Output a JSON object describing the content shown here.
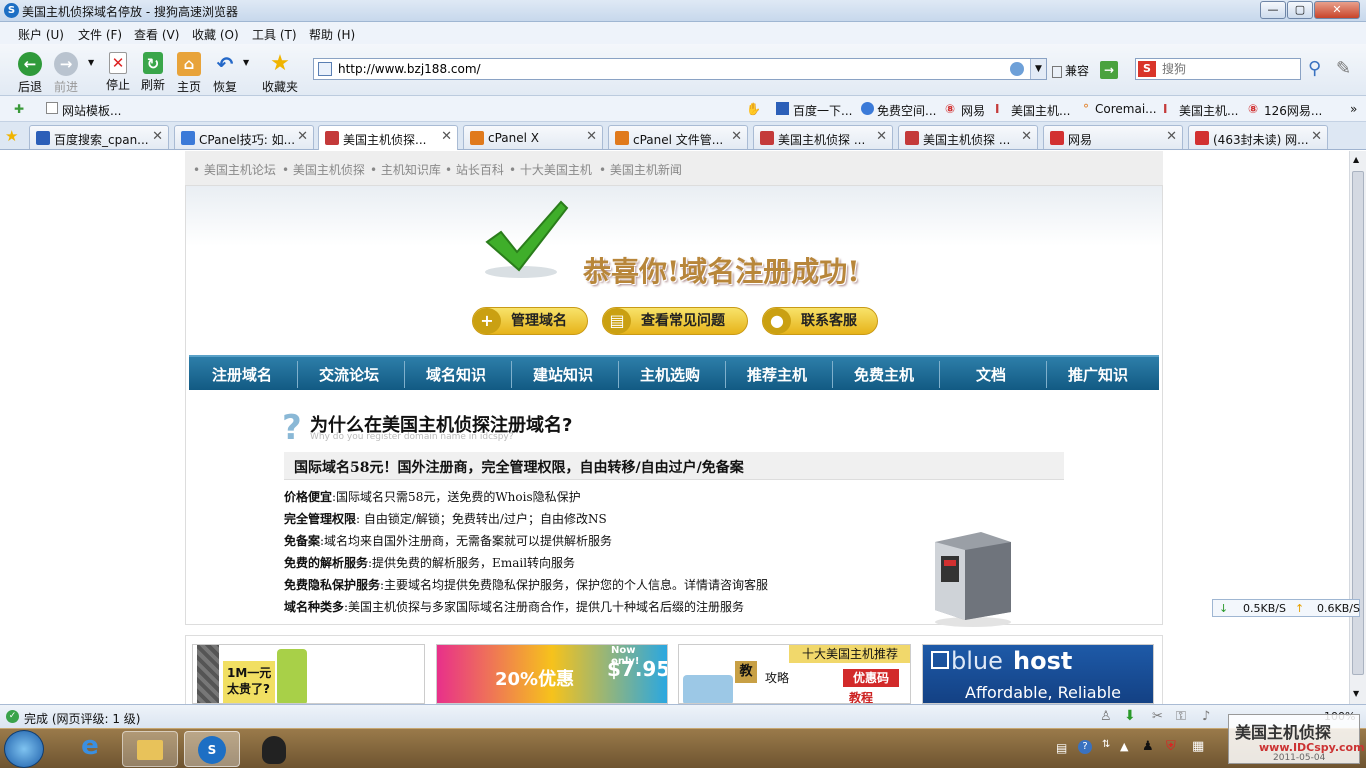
{
  "window": {
    "title": "美国主机侦探域名停放 - 搜狗高速浏览器"
  },
  "menu": [
    "账户 (U)",
    "文件 (F)",
    "查看 (V)",
    "收藏 (O)",
    "工具 (T)",
    "帮助 (H)"
  ],
  "toolbar": {
    "back": "后退",
    "forward": "前进",
    "stop": "停止",
    "refresh": "刷新",
    "home": "主页",
    "restore": "恢复",
    "favorites": "收藏夹"
  },
  "address": {
    "url": "http://www.bzj188.com/",
    "compat": "兼容",
    "search_placeholder": "搜狗"
  },
  "favbar": {
    "left": "网站模板...",
    "items": [
      "百度一下...",
      "免费空间...",
      "网易",
      "美国主机...",
      "Coremai...",
      "美国主机...",
      "126网易..."
    ]
  },
  "tabs": [
    {
      "label": "百度搜索_cpan...",
      "color": "#2c5fb8"
    },
    {
      "label": "CPanel技巧: 如...",
      "color": "#3b7ad8"
    },
    {
      "label": "美国主机侦探...",
      "color": "#c43a3a"
    },
    {
      "label": "cPanel X",
      "color": "#e07a1c"
    },
    {
      "label": "cPanel 文件管...",
      "color": "#e07a1c"
    },
    {
      "label": "美国主机侦探 ...",
      "color": "#c43a3a"
    },
    {
      "label": "美国主机侦探 ...",
      "color": "#c43a3a"
    },
    {
      "label": "网易",
      "color": "#d23131"
    },
    {
      "label": "(463封未读) 网...",
      "color": "#d23131"
    }
  ],
  "page": {
    "topnav": [
      "• 美国主机论坛",
      "• 美国主机侦探",
      "• 主机知识库",
      "• 站长百科",
      "• 十大美国主机",
      "• 美国主机新闻"
    ],
    "success": "恭喜你!域名注册成功!",
    "buttons": [
      "管理域名",
      "查看常见问题",
      "联系客服"
    ],
    "nav": [
      "注册域名",
      "交流论坛",
      "域名知识",
      "建站知识",
      "主机选购",
      "推荐主机",
      "免费主机",
      "文档",
      "推广知识"
    ],
    "why_title": "为什么在美国主机侦探注册域名?",
    "why_sub": "Why do you register domain name in idcspy?",
    "highlight": "国际域名58元！国外注册商，完全管理权限，自由转移/自由过户/免备案",
    "features": [
      {
        "k": "价格便宜",
        "v": ":国际域名只需58元，送免费的Whois隐私保护"
      },
      {
        "k": "完全管理权限",
        "v": ": 自由锁定/解锁；免费转出/过户；自由修改NS"
      },
      {
        "k": "免备案",
        "v": ":域名均来自国外注册商，无需备案就可以提供解析服务"
      },
      {
        "k": "免费的解析服务",
        "v": ":提供免费的解析服务，Email转向服务"
      },
      {
        "k": "免费隐私保护服务",
        "v": ":主要域名均提供免费隐私保护服务，保护您的个人信息。详情请咨询客服"
      },
      {
        "k": "域名种类多",
        "v": ":美国主机侦探与多家国际域名注册商合作，提供几十种域名后缀的注册服务"
      }
    ],
    "banners": {
      "b1": "1M一元\n太贵了?",
      "b2_badge": "Now only!",
      "b2_price": "$7.95",
      "b2_text": "20%优惠",
      "b3_title": "十大美国主机推荐",
      "b3_a": "教",
      "b3_b": "攻略",
      "b3_c": "优惠码",
      "b3_d": "教程",
      "b4_a": "blue",
      "b4_b": "host",
      "b4_c": "Affordable, Reliable"
    }
  },
  "speed": {
    "down": "0.5KB/S",
    "up": "0.6KB/S"
  },
  "status": {
    "text": "完成 (网页评级: 1 级)",
    "zoom": "100%"
  },
  "watermark": {
    "line1": "美国主机侦探",
    "line2": "www.IDCspy.com",
    "line3": "2011-05-04"
  }
}
